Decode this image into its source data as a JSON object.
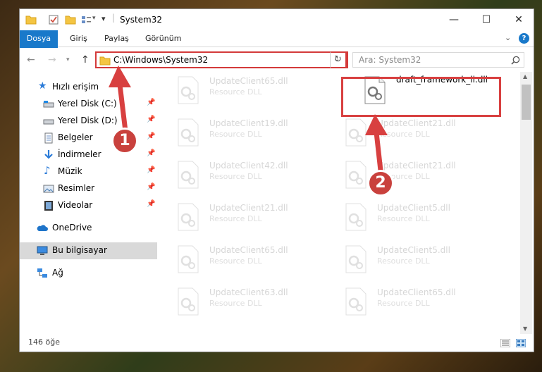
{
  "window": {
    "title": "System32",
    "controls": {
      "minimize": "—",
      "maximize": "☐",
      "close": "✕"
    }
  },
  "ribbon": {
    "tabs": [
      "Dosya",
      "Giriş",
      "Paylaş",
      "Görünüm"
    ],
    "help": "?"
  },
  "navbar": {
    "back": "←",
    "forward": "→",
    "up": "↑",
    "address": "C:\\Windows\\System32",
    "search_placeholder": "Ara: System32"
  },
  "nav_pane": {
    "quick_access": "Hızlı erişim",
    "items": [
      {
        "label": "Yerel Disk (C:)",
        "icon": "drive-icon",
        "pinned": true
      },
      {
        "label": "Yerel Disk (D:)",
        "icon": "drive-icon",
        "pinned": true
      },
      {
        "label": "Belgeler",
        "icon": "documents-icon",
        "pinned": true
      },
      {
        "label": "İndirmeler",
        "icon": "downloads-icon",
        "pinned": true
      },
      {
        "label": "Müzik",
        "icon": "music-icon",
        "pinned": true
      },
      {
        "label": "Resimler",
        "icon": "pictures-icon",
        "pinned": true
      },
      {
        "label": "Videolar",
        "icon": "videos-icon",
        "pinned": true
      }
    ],
    "onedrive": "OneDrive",
    "this_pc": "Bu bilgisayar",
    "network": "Ağ"
  },
  "files": {
    "left_column": [
      {
        "name": "UpdateClient65.dll",
        "type": "Resource DLL"
      },
      {
        "name": "UpdateClient19.dll",
        "type": "Resource DLL"
      },
      {
        "name": "UpdateClient42.dll",
        "type": "Resource DLL"
      },
      {
        "name": "UpdateClient21.dll",
        "type": "Resource DLL"
      },
      {
        "name": "UpdateClient65.dll",
        "type": "Resource DLL"
      },
      {
        "name": "UpdateClient63.dll",
        "type": "Resource DLL"
      }
    ],
    "right_column": [
      {
        "name": "draft_framework_li.dll",
        "type": ""
      },
      {
        "name": "UpdateClient21.dll",
        "type": "Resource DLL"
      },
      {
        "name": "UpdateClient21.dll",
        "type": "Resource DLL"
      },
      {
        "name": "UpdateClient5.dll",
        "type": "Resource DLL"
      },
      {
        "name": "UpdateClient5.dll",
        "type": "Resource DLL"
      },
      {
        "name": "UpdateClient65.dll",
        "type": "Resource DLL"
      }
    ]
  },
  "status": {
    "item_count": "146 öğe"
  },
  "annotations": {
    "step1": "1",
    "step2": "2",
    "color": "#d84040"
  }
}
